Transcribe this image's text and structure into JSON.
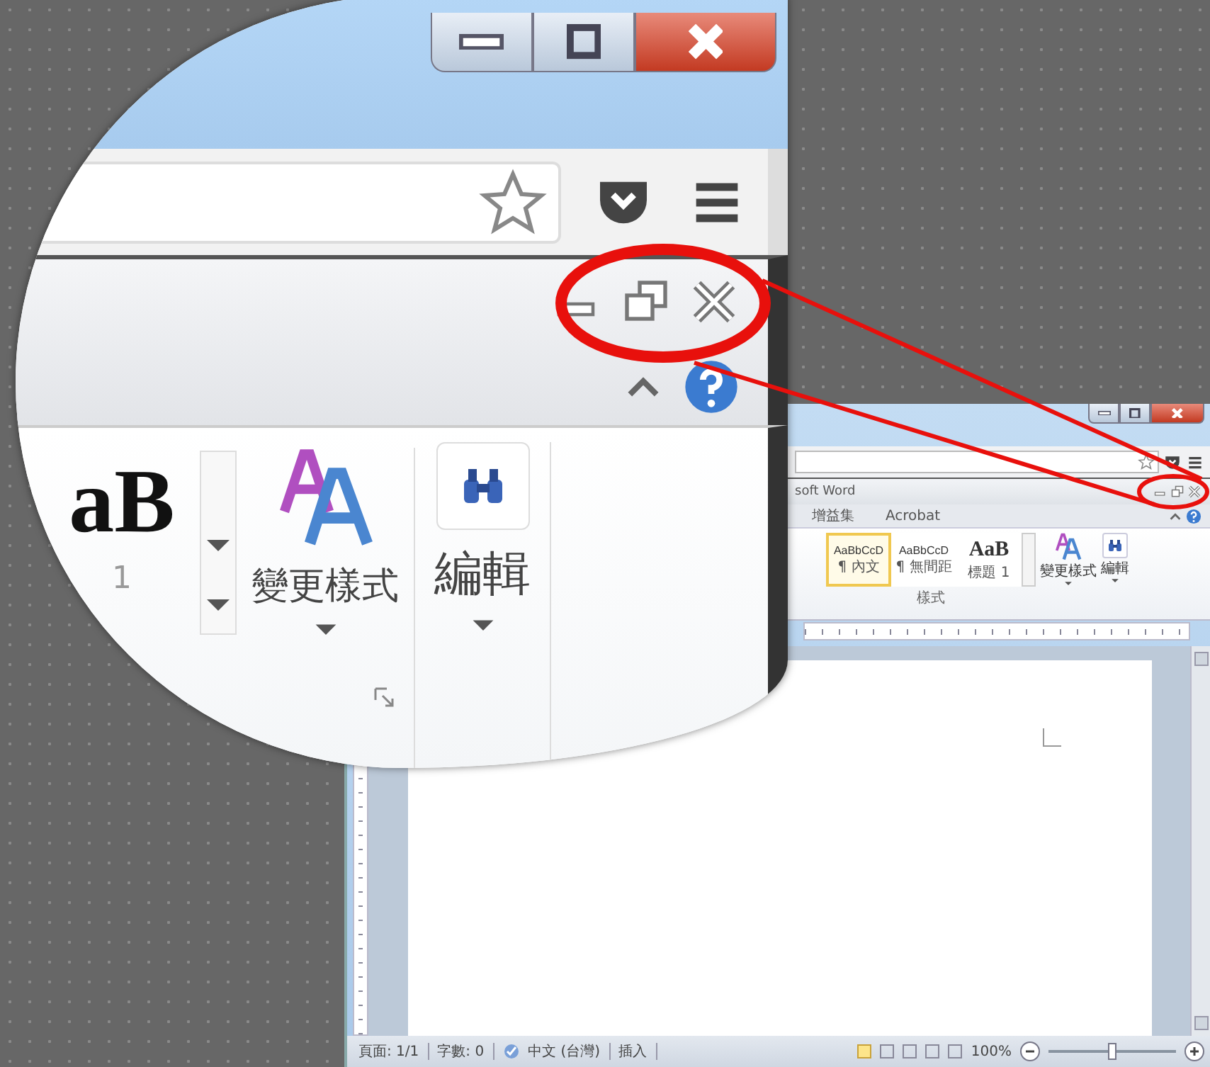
{
  "magnifier": {
    "gallery_sample": "aB",
    "gallery_label": "1",
    "change_styles": "變更樣式",
    "edit": "編輯"
  },
  "word_window": {
    "title": "soft Word",
    "tabs": [
      {
        "label": "增益集",
        "selected": false
      },
      {
        "label": "Acrobat",
        "selected": false
      }
    ],
    "styles": [
      {
        "kind": "text",
        "sample": "AaBbCcD",
        "name": "¶ 內文",
        "selected": true
      },
      {
        "kind": "text",
        "sample": "AaBbCcD",
        "name": "¶ 無間距",
        "selected": false
      },
      {
        "kind": "heading",
        "sample": "AaB",
        "name": "標題 1",
        "selected": false
      }
    ],
    "group_label": "樣式",
    "change_styles": "變更樣式",
    "edit": "編輯",
    "status_bar": {
      "page": "頁面: 1/1",
      "words": "字數: 0",
      "language": "中文 (台灣)",
      "mode": "插入",
      "zoom": "100%",
      "zoom_slider": {
        "level": 0.5
      }
    }
  }
}
